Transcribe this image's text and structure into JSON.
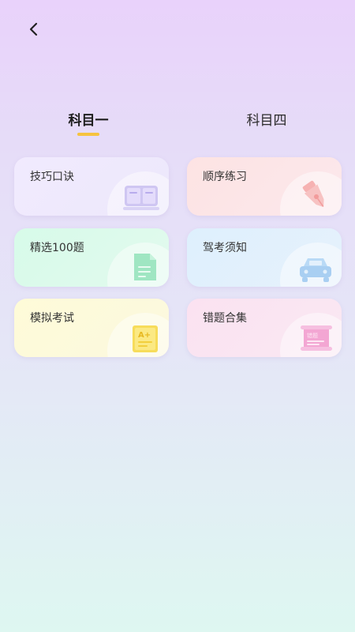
{
  "header": {
    "back_icon": "chevron-left-icon"
  },
  "tabs": [
    {
      "label": "科目一",
      "active": true
    },
    {
      "label": "科目四",
      "active": false
    }
  ],
  "colors": {
    "accent": "#f6c33f"
  },
  "cards": [
    {
      "label": "技巧口诀",
      "icon": "book-icon"
    },
    {
      "label": "顺序练习",
      "icon": "pen-nib-icon"
    },
    {
      "label": "精选100题",
      "icon": "document-icon"
    },
    {
      "label": "驾考须知",
      "icon": "car-icon"
    },
    {
      "label": "模拟考试",
      "icon": "exam-paper-icon",
      "icon_text": "A+"
    },
    {
      "label": "错题合集",
      "icon": "scroll-icon",
      "icon_text": "错题"
    }
  ]
}
